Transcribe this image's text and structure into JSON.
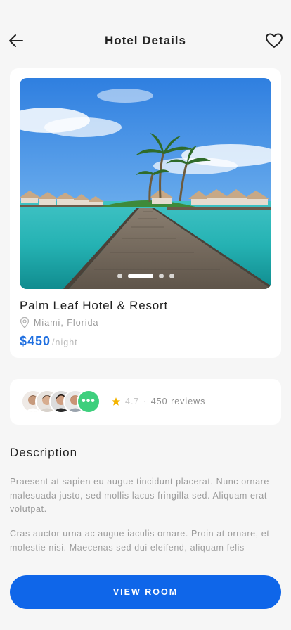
{
  "header": {
    "title": "Hotel Details",
    "back_icon": "arrow-left-icon",
    "favorite_icon": "heart-icon"
  },
  "hotel": {
    "name": "Palm Leaf Hotel & Resort",
    "location": "Miami, Florida",
    "price": "$450",
    "price_unit": "/night",
    "carousel": {
      "count": 4,
      "active_index": 1
    }
  },
  "reviews": {
    "more_label": "•••",
    "rating": "4.7",
    "separator": "·",
    "count_label": "450 reviews"
  },
  "description": {
    "heading": "Description",
    "paragraphs": [
      "Praesent at sapien eu augue tincidunt placerat. Nunc ornare malesuada justo, sed mollis lacus fringilla sed. Aliquam erat volutpat.",
      "Cras auctor urna ac augue iaculis ornare. Proin at ornare, et molestie nisi. Maecenas sed dui eleifend, aliquam felis"
    ]
  },
  "cta": {
    "label": "VIEW ROOM"
  },
  "colors": {
    "accent": "#0f66e9",
    "price": "#1f6fe0",
    "more_avatar": "#3ecf7d",
    "star": "#f4b400"
  }
}
